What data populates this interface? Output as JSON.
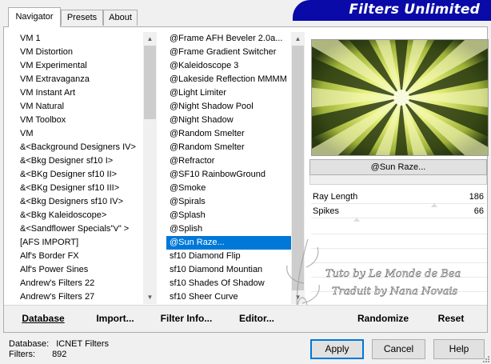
{
  "tabs": [
    {
      "label": "Navigator",
      "active": true
    },
    {
      "label": "Presets",
      "active": false
    },
    {
      "label": "About",
      "active": false
    }
  ],
  "brand": {
    "title": "Filters Unlimited",
    "color": "#0a0aa8"
  },
  "categories": [
    "VM 1",
    "VM Distortion",
    "VM Experimental",
    "VM Extravaganza",
    "VM Instant Art",
    "VM Natural",
    "VM Toolbox",
    "VM",
    "&<Background Designers IV>",
    "&<Bkg Designer sf10 I>",
    "&<BKg Designer sf10 II>",
    "&<BKg Designer sf10 III>",
    "&<Bkg Designers sf10 IV>",
    "&<Bkg Kaleidoscope>",
    "&<Sandflower Specials\"v\" >",
    "[AFS IMPORT]",
    "Alf's Border FX",
    "Alf's Power Sines",
    "Andrew's Filters 22",
    "Andrew's Filters 27"
  ],
  "filters": [
    {
      "label": "@Frame AFH Beveler 2.0a...",
      "selected": false
    },
    {
      "label": "@Frame Gradient Switcher",
      "selected": false
    },
    {
      "label": "@Kaleidoscope 3",
      "selected": false
    },
    {
      "label": "@Lakeside Reflection MMMM",
      "selected": false
    },
    {
      "label": "@Light Limiter",
      "selected": false
    },
    {
      "label": "@Night Shadow Pool",
      "selected": false
    },
    {
      "label": "@Night Shadow",
      "selected": false
    },
    {
      "label": "@Random Smelter",
      "selected": false
    },
    {
      "label": "@Random Smelter",
      "selected": false
    },
    {
      "label": "@Refractor",
      "selected": false
    },
    {
      "label": "@SF10 RainbowGround",
      "selected": false
    },
    {
      "label": "@Smoke",
      "selected": false
    },
    {
      "label": "@Spirals",
      "selected": false
    },
    {
      "label": "@Splash",
      "selected": false
    },
    {
      "label": "@Splish",
      "selected": false
    },
    {
      "label": "@Sun Raze...",
      "selected": true
    },
    {
      "label": "sf10 Diamond Flip",
      "selected": false
    },
    {
      "label": "sf10 Diamond Mountian",
      "selected": false
    },
    {
      "label": "sf10 Shades Of Shadow",
      "selected": false
    },
    {
      "label": "sf10 Sheer Curve",
      "selected": false
    }
  ],
  "current_filter": "@Sun Raze...",
  "params": [
    {
      "name": "Ray Length",
      "value": "186"
    },
    {
      "name": "Spikes",
      "value": "66"
    }
  ],
  "watermark": {
    "line1": "Tuto by Le Monde de Bea",
    "line2": "Traduit by Nana Novais"
  },
  "action_buttons": {
    "database": "Database",
    "import": "Import...",
    "filter_info": "Filter Info...",
    "editor": "Editor...",
    "randomize": "Randomize",
    "reset": "Reset"
  },
  "info": {
    "database_label": "Database:",
    "database_value": "ICNET Filters",
    "filters_label": "Filters:",
    "filters_value": "892"
  },
  "buttons": {
    "apply": "Apply",
    "cancel": "Cancel",
    "help": "Help"
  },
  "colors": {
    "selection": "#0078d7",
    "preview_yellow": "#e8f07a",
    "preview_dark": "#1a2a10"
  }
}
